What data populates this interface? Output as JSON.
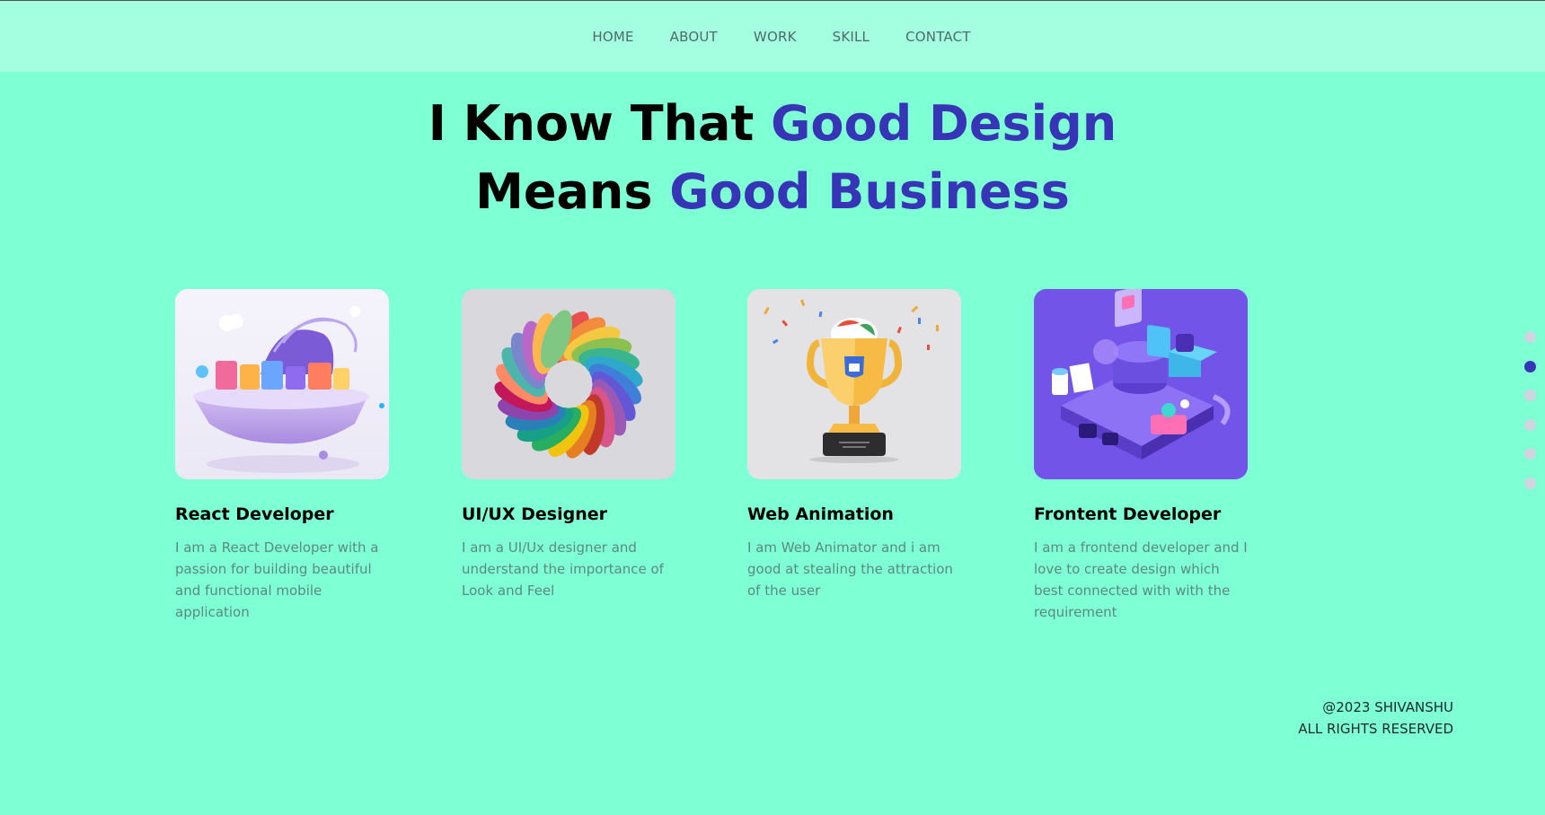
{
  "nav": {
    "items": [
      {
        "label": "HOME"
      },
      {
        "label": "ABOUT"
      },
      {
        "label": "WORK"
      },
      {
        "label": "SKILL"
      },
      {
        "label": "CONTACT"
      }
    ]
  },
  "hero": {
    "line1_plain": "I Know That ",
    "line1_accent": "Good Design",
    "line2_plain": "Means ",
    "line2_accent": "Good Business"
  },
  "cards": [
    {
      "title": "React Developer",
      "description": "I am a React Developer with a passion for building beautiful and functional mobile application",
      "image_icon": "play-island-illustration"
    },
    {
      "title": "UI/UX Designer",
      "description": "I am a UI/Ux designer and understand the importance of Look and Feel",
      "image_icon": "color-swatch-ring-illustration"
    },
    {
      "title": "Web Animation",
      "description": "I am Web Animator and i am good at stealing the attraction of the user",
      "image_icon": "trophy-illustration"
    },
    {
      "title": "Frontent Developer",
      "description": "I am a frontend developer and I love to create design which best connected with with the requirement",
      "image_icon": "isometric-workstation-illustration"
    }
  ],
  "pager": {
    "count": 6,
    "active_index": 1
  },
  "footer": {
    "copyright": "@2023 SHIVANSHU",
    "rights": "ALL RIGHTS RESERVED"
  },
  "colors": {
    "background": "#7fffd4",
    "navbar": "#a3ffe0",
    "accent": "#3535b6",
    "text_muted": "#5a8a80",
    "dot_inactive": "#cfd4df"
  }
}
